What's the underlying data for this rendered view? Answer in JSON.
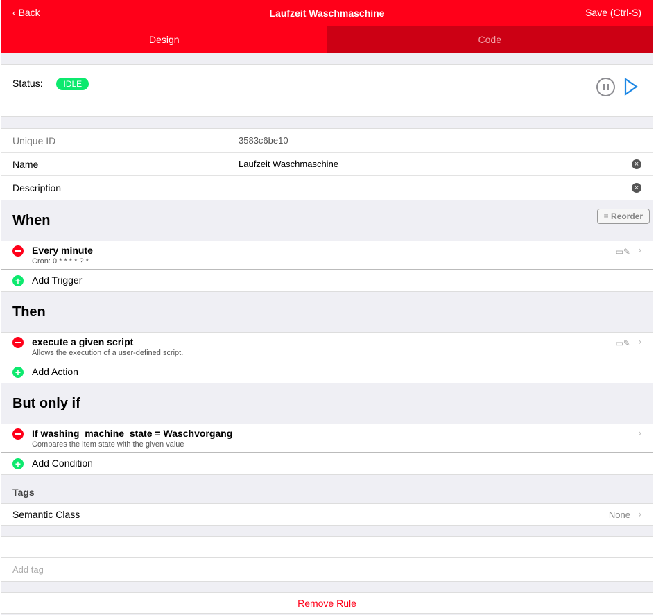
{
  "nav": {
    "back": "Back",
    "title": "Laufzeit Waschmaschine",
    "save": "Save (Ctrl-S)"
  },
  "tabs": [
    "Design",
    "Code"
  ],
  "status": {
    "label": "Status:",
    "value": "IDLE"
  },
  "fields": [
    {
      "label": "Unique ID",
      "value": "3583c6be10"
    },
    {
      "label": "Name",
      "value": "Laufzeit Waschmaschine"
    },
    {
      "label": "Description",
      "value": ""
    }
  ],
  "when": {
    "title": "When",
    "reorder": "Reorder",
    "items": [
      {
        "title": "Every minute",
        "subtitle": "Cron: 0 * * * * ? *"
      }
    ],
    "add": "Add Trigger"
  },
  "then": {
    "title": "Then",
    "items": [
      {
        "title": "execute a given script",
        "subtitle": "Allows the execution of a user-defined script."
      }
    ],
    "add": "Add Action"
  },
  "onlyif": {
    "title": "But only if",
    "items": [
      {
        "title": "If washing_machine_state = Waschvorgang",
        "subtitle": "Compares the item state with the given value"
      }
    ],
    "add": "Add Condition"
  },
  "tags": {
    "title": "Tags",
    "semantic_label": "Semantic Class",
    "semantic_value": "None",
    "placeholder": "Add tag"
  },
  "remove": "Remove Rule",
  "colors": {
    "accent": "#ff0019",
    "idle": "#0de96e",
    "play": "#1e88e5"
  }
}
